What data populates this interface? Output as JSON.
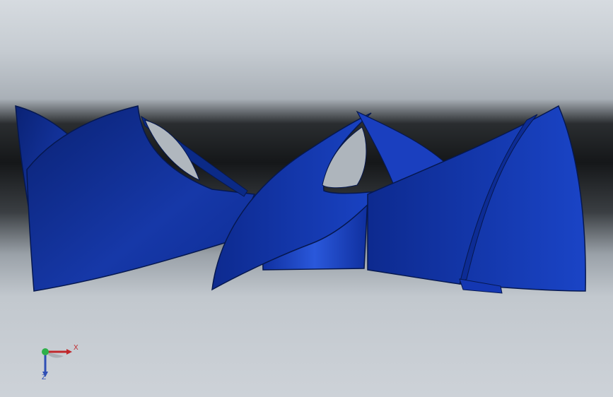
{
  "viewport": {
    "background_top": "#d6dbe0",
    "background_band": "#151719",
    "model_color": "#1234a8",
    "model_dark": "#0b2277",
    "model_light": "#2a55d8"
  },
  "triad": {
    "x_label": "X",
    "z_label": "Z",
    "x_color": "#c0282c",
    "y_color": "#2fb04a",
    "z_color": "#2f4fb5"
  }
}
